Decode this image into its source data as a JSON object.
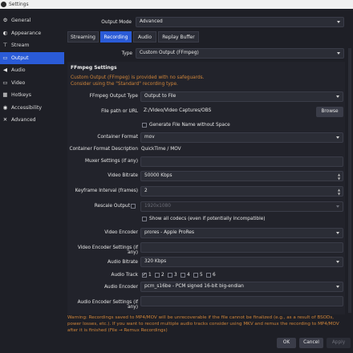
{
  "window": {
    "title": "Settings"
  },
  "sidebar": {
    "items": [
      {
        "label": "General",
        "icon": "gear-icon",
        "glyph": "⚙"
      },
      {
        "label": "Appearance",
        "icon": "palette-icon",
        "glyph": "◐"
      },
      {
        "label": "Stream",
        "icon": "antenna-icon",
        "glyph": "⊤"
      },
      {
        "label": "Output",
        "icon": "output-icon",
        "glyph": "▭"
      },
      {
        "label": "Audio",
        "icon": "speaker-icon",
        "glyph": "◀"
      },
      {
        "label": "Video",
        "icon": "monitor-icon",
        "glyph": "▭"
      },
      {
        "label": "Hotkeys",
        "icon": "keyboard-icon",
        "glyph": "▦"
      },
      {
        "label": "Accessibility",
        "icon": "accessibility-icon",
        "glyph": "◉"
      },
      {
        "label": "Advanced",
        "icon": "wrench-icon",
        "glyph": "✕"
      }
    ]
  },
  "output_mode": {
    "label": "Output Mode",
    "value": "Advanced"
  },
  "tabs": [
    "Streaming",
    "Recording",
    "Audio",
    "Replay Buffer"
  ],
  "type": {
    "label": "Type",
    "value": "Custom Output (FFmpeg)"
  },
  "ffmpeg": {
    "title": "FFmpeg Settings",
    "warning_line1": "Custom Output (FFmpeg) is provided with no safeguards.",
    "warning_line2": "Consider using the \"Standard\" recording type.",
    "output_type": {
      "label": "FFmpeg Output Type",
      "value": "Output to File"
    },
    "file_path": {
      "label": "File path or URL",
      "value": "Z:/Video/Video Captures/OBS",
      "browse": "Browse"
    },
    "gen_filename": "Generate File Name without Space",
    "container_format": {
      "label": "Container Format",
      "value": "mov"
    },
    "container_desc": {
      "label": "Container Format Description",
      "value": "QuickTime / MOV"
    },
    "muxer": {
      "label": "Muxer Settings (if any)",
      "value": ""
    },
    "video_bitrate": {
      "label": "Video Bitrate",
      "value": "50000 Kbps"
    },
    "keyframe": {
      "label": "Keyframe Interval (frames)",
      "value": "2"
    },
    "rescale": {
      "label": "Rescale Output",
      "value": "1920x1080"
    },
    "show_all_codecs": "Show all codecs (even if potentially incompatible)",
    "video_encoder": {
      "label": "Video Encoder",
      "value": "prores - Apple ProRes"
    },
    "video_enc_settings": {
      "label": "Video Encoder Settings (if any)",
      "value": ""
    },
    "audio_bitrate": {
      "label": "Audio Bitrate",
      "value": "320 Kbps"
    },
    "audio_track": {
      "label": "Audio Track",
      "tracks": [
        "1",
        "2",
        "3",
        "4",
        "5",
        "6"
      ],
      "checked": [
        true,
        false,
        false,
        false,
        false,
        false
      ]
    },
    "audio_encoder": {
      "label": "Audio Encoder",
      "value": "pcm_s16be - PCM signed 16-bit big-endian"
    },
    "audio_enc_settings": {
      "label": "Audio Encoder Settings (if any)",
      "value": ""
    }
  },
  "bottom_warning": "Warning: Recordings saved to MP4/MOV will be unrecoverable if the file cannot be finalized (e.g., as a result of BSODs, power losses, etc.). If you want to record multiple audio tracks consider using MKV and remux the recording to MP4/MOV after it is finished (File → Remux Recordings)",
  "buttons": {
    "ok": "OK",
    "cancel": "Cancel",
    "apply": "Apply"
  }
}
